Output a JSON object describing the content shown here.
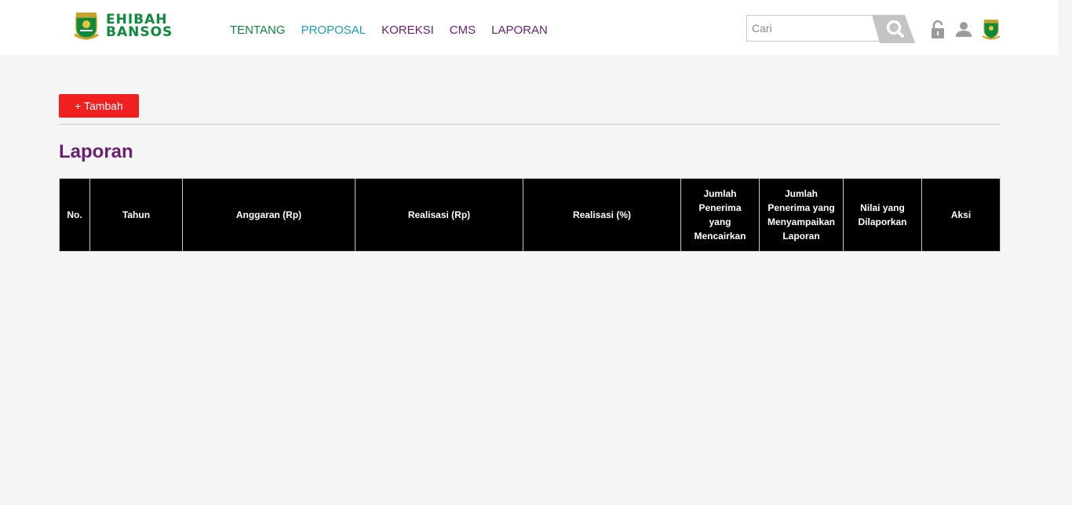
{
  "header": {
    "logo_line1": "EHIBAH",
    "logo_line2": "BANSOS",
    "nav": [
      {
        "label": "TENTANG",
        "color": "#0e8a3c"
      },
      {
        "label": "PROPOSAL",
        "color": "#1aa0b0"
      },
      {
        "label": "KOREKSI",
        "color": "#6a1f74"
      },
      {
        "label": "CMS",
        "color": "#6a1f74"
      },
      {
        "label": "LAPORAN",
        "color": "#6a1f74"
      }
    ],
    "search_placeholder": "Cari",
    "icons": [
      "search-icon",
      "lock-icon",
      "user-icon",
      "emblem-icon"
    ]
  },
  "main": {
    "add_button": "+ Tambah",
    "title": "Laporan",
    "table_headers": [
      "No.",
      "Tahun",
      "Anggaran (Rp)",
      "Realisasi (Rp)",
      "Realisasi (%)",
      "Jumlah Penerima yang Mencairkan",
      "Jumlah Penerima yang Menyampaikan Laporan",
      "Nilai yang Dilaporkan",
      "Aksi"
    ]
  },
  "colors": {
    "accent_green": "#0e8a3c",
    "accent_purple": "#6a1f74",
    "button_red": "#f02021"
  }
}
